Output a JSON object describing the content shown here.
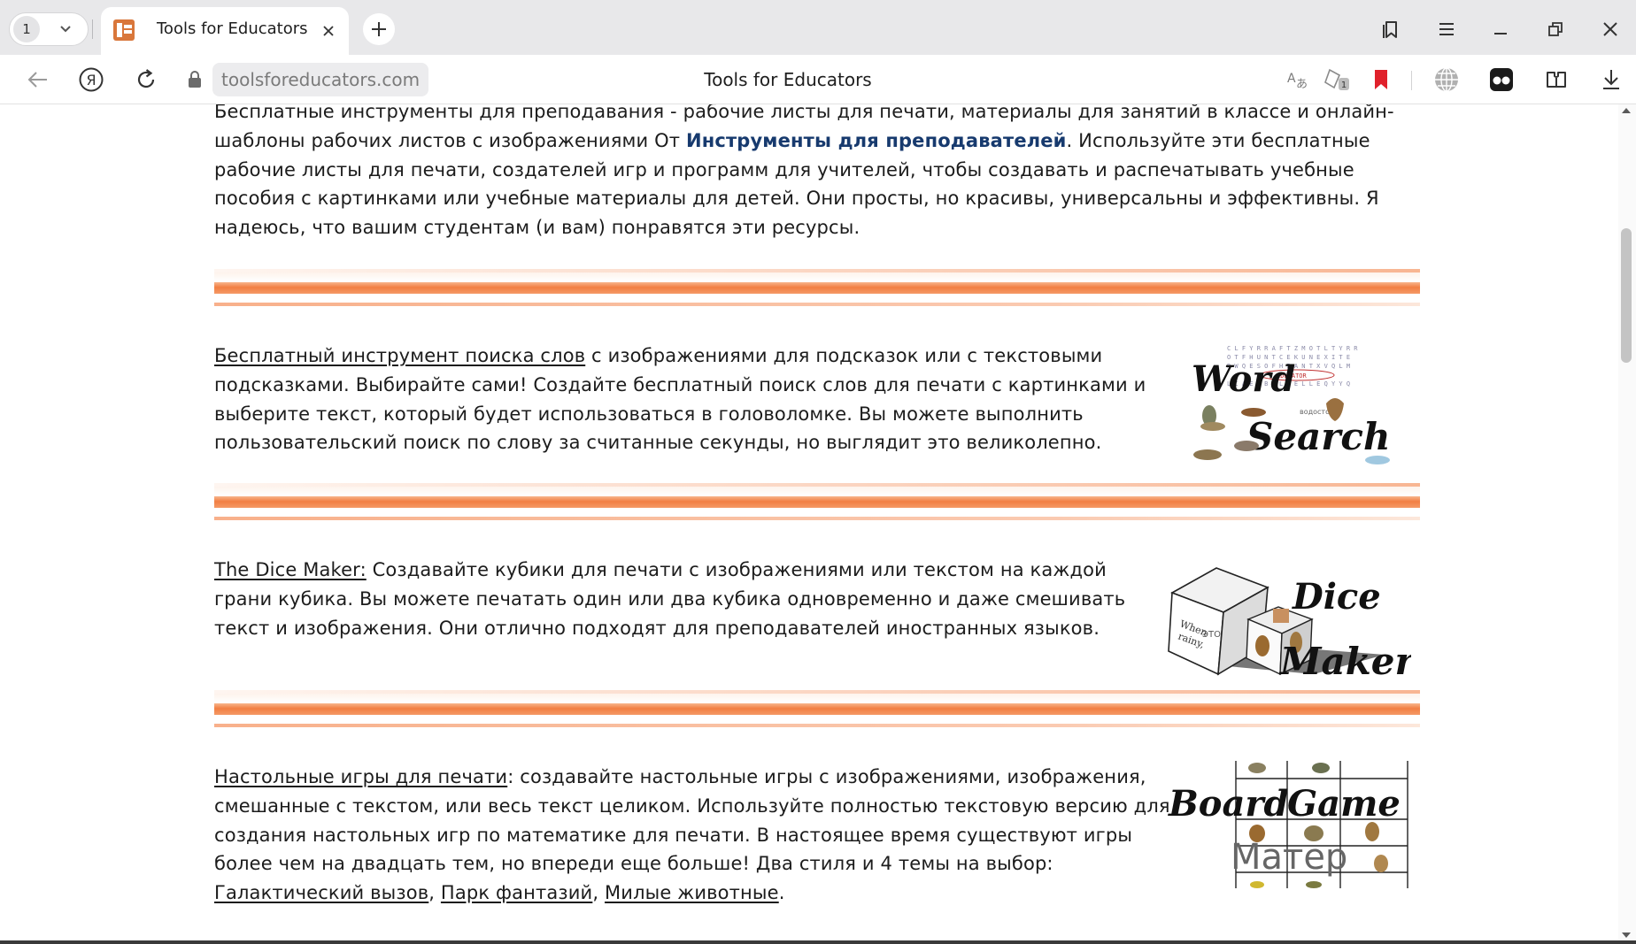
{
  "browser": {
    "tab_count": "1",
    "tab": {
      "title": "Tools for Educators"
    },
    "address": {
      "url": "toolsforeducators.com",
      "page_title": "Tools for Educators"
    }
  },
  "content": {
    "intro": {
      "line1": "Бесплатные инструменты для преподавания - рабочие листы для печати, материалы для занятий в классе и онлайн-",
      "line2_before": "шаблоны рабочих листов с изображениями От ",
      "line2_link": "Инструменты для преподавателей",
      "line2_after": ". Используйте эти бесплатные",
      "rest": "рабочие листы для печати, создателей игр и программ для учителей, чтобы создавать и распечатывать учебные пособия с картинками или учебные материалы для детей. Они просты, но красивы, универсальны и эффективны. Я надеюсь, что вашим студентам (и вам) понравятся эти ресурсы."
    },
    "word_search": {
      "link": "Бесплатный инструмент поиска слов",
      "text": " с изображениями для подсказок или с текстовыми подсказками. Выбирайте сами! Создайте бесплатный поиск слов для печати с картинками и выберите текст, который будет использоваться в головоломке. Вы можете выполнить пользовательский поиск по слову за считанные секунды, но выглядит это великолепно.",
      "image_words": [
        "Word",
        "Search",
        "EDUCATOR",
        "водосток"
      ]
    },
    "dice_maker": {
      "link": "The Dice Maker:",
      "text": " Создавайте кубики для печати с изображениями или текстом на каждой грани кубика. Вы можете печатать один или два кубика одновременно и даже смешивать текст и изображения. Они отлично подходят для преподавателей иностранных языков.",
      "image_words": [
        "Dice",
        "Maker",
        "When",
        "rainy,",
        "ЭТО"
      ]
    },
    "board_game": {
      "link": "Настольные игры для печати",
      "text": ": создавайте настольные игры с изображениями, изображения, смешанные с текстом, или весь текст целиком. Используйте полностью текстовую версию для создания настольных игр по математике для печати. В настоящее время существуют игры более чем на двадцать тем, но впереди еще больше! Два стиля и 4 темы на выбор: ",
      "theme_links": [
        "Галактический вызов",
        "Парк фантазий",
        "Милые животные"
      ],
      "sep": ", ",
      "end": ".",
      "image_words": [
        "Board",
        "Game",
        "Матер"
      ]
    }
  },
  "icons": {
    "tab_dropdown": "chevron-down-icon",
    "tab_close": "close-icon",
    "new_tab": "plus-icon",
    "bookmarks": "bookmarks-icon",
    "menu": "hamburger-menu-icon",
    "minimize": "minimize-icon",
    "restore": "restore-icon",
    "close": "close-icon",
    "back": "arrow-left-icon",
    "yandex": "yandex-logo-icon",
    "reload": "reload-icon",
    "lock": "lock-icon",
    "translate": "translate-icon",
    "protect": "protect-icon",
    "bookmark": "bookmark-icon",
    "vpn": "globe-icon",
    "extension_alice": "alice-icon",
    "extensions": "extensions-icon",
    "downloads": "download-icon"
  },
  "colors": {
    "divider_orange": "#f27f43",
    "link_blue": "#173a6e",
    "tab_bar": "#e8e8ea",
    "bookmark_red": "#e0212b"
  }
}
